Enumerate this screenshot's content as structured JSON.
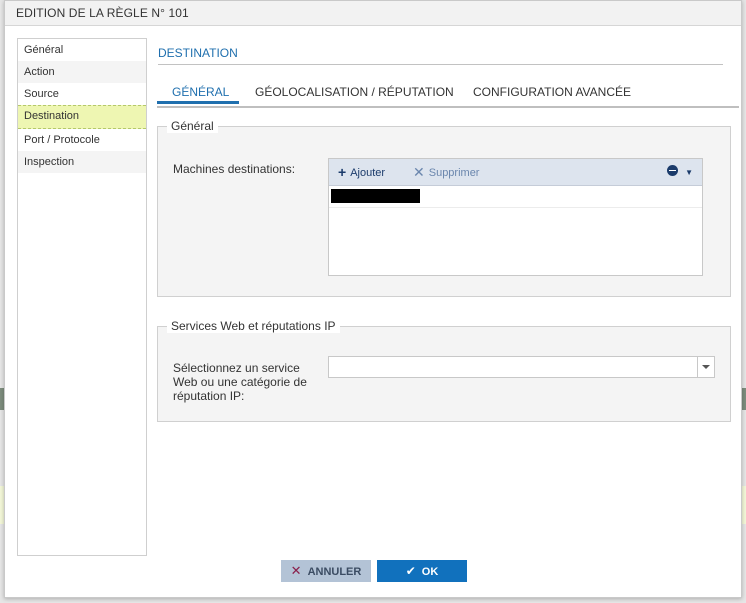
{
  "dialog": {
    "title": "EDITION DE LA RÈGLE N° 101"
  },
  "nav": {
    "items": [
      {
        "label": "Général"
      },
      {
        "label": "Action"
      },
      {
        "label": "Source"
      },
      {
        "label": "Destination",
        "active": true
      },
      {
        "label": "Port / Protocole"
      },
      {
        "label": "Inspection"
      }
    ]
  },
  "section": {
    "title": "DESTINATION"
  },
  "tabs": [
    {
      "label": "GÉNÉRAL",
      "active": true
    },
    {
      "label": "GÉOLOCALISATION / RÉPUTATION"
    },
    {
      "label": "CONFIGURATION AVANCÉE"
    }
  ],
  "general": {
    "legend": "Général",
    "machines_label": "Machines destinations:",
    "add_label": "Ajouter",
    "delete_label": "Supprimer"
  },
  "services": {
    "legend": "Services Web et réputations IP",
    "select_label": "Sélectionnez un service Web ou une catégorie de réputation IP:",
    "select_value": ""
  },
  "footer": {
    "cancel_label": "ANNULER",
    "ok_label": "OK"
  },
  "icons": {
    "add": "plus-icon",
    "delete": "x-icon",
    "menu": "circle-minus-icon",
    "cancel": "x-icon",
    "ok": "check-icon"
  }
}
